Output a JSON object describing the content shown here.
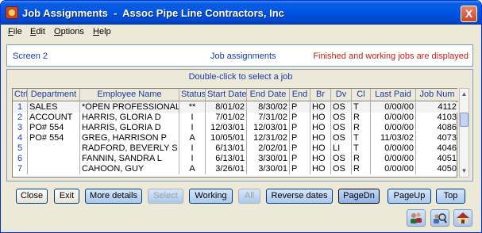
{
  "window": {
    "title": "Job Assignments  -  Assoc Pipe Line Contractors, Inc",
    "close_glyph": "X"
  },
  "menu": [
    {
      "first": "F",
      "rest": "ile"
    },
    {
      "first": "E",
      "rest": "dit"
    },
    {
      "first": "O",
      "rest": "ptions"
    },
    {
      "first": "H",
      "rest": "elp"
    }
  ],
  "header": {
    "screen": "Screen 2",
    "title": "Job assignments",
    "status": "Finished and working jobs are displayed"
  },
  "grid": {
    "caption": "Double-click to select a job",
    "columns": [
      "Ctrl",
      "Department",
      "Employee Name",
      "Status",
      "Start Date",
      "End Date",
      "End",
      "Br",
      "Dv",
      "Cl",
      "Last Paid",
      "Job Num"
    ],
    "rows": [
      {
        "ctrl": "1",
        "department": "SALES",
        "employee": "*OPEN PROFESSIONAL",
        "status": "**",
        "start": "8/01/02",
        "end_date": "8/30/02",
        "end": "P",
        "br": "HO",
        "dv": "OS",
        "cl": "T",
        "last_paid": "0/00/00",
        "job_num": "4112"
      },
      {
        "ctrl": "2",
        "department": "ACCOUNT",
        "employee": "HARRIS, GLORIA D",
        "status": "I",
        "start": "7/01/02",
        "end_date": "7/31/02",
        "end": "P",
        "br": "HO",
        "dv": "OS",
        "cl": "R",
        "last_paid": "0/00/00",
        "job_num": "4103"
      },
      {
        "ctrl": "3",
        "department": "PO# 554",
        "employee": "HARRIS, GLORIA D",
        "status": "I",
        "start": "12/03/01",
        "end_date": "12/03/01",
        "end": "P",
        "br": "HO",
        "dv": "OS",
        "cl": "R",
        "last_paid": "0/00/00",
        "job_num": "4086"
      },
      {
        "ctrl": "4",
        "department": "PO# 554",
        "employee": "GREG, HARRISON P",
        "status": "A",
        "start": "10/05/01",
        "end_date": "12/31/02",
        "end": "P",
        "br": "HO",
        "dv": "OS",
        "cl": "T",
        "last_paid": "11/03/02",
        "job_num": "4073"
      },
      {
        "ctrl": "5",
        "department": "",
        "employee": "RADFORD, BEVERLY S",
        "status": "I",
        "start": "6/13/01",
        "end_date": "2/02/01",
        "end": "P",
        "br": "HO",
        "dv": "LI",
        "cl": "T",
        "last_paid": "0/00/00",
        "job_num": "4046"
      },
      {
        "ctrl": "6",
        "department": "",
        "employee": "FANNIN, SANDRA L",
        "status": "I",
        "start": "6/13/01",
        "end_date": "3/30/01",
        "end": "P",
        "br": "HO",
        "dv": "OS",
        "cl": "R",
        "last_paid": "0/00/00",
        "job_num": "4051"
      },
      {
        "ctrl": "7",
        "department": "",
        "employee": "CAHOON, GUY",
        "status": "A",
        "start": "3/26/01",
        "end_date": "3/30/01",
        "end": "P",
        "br": "HO",
        "dv": "OS",
        "cl": "R",
        "last_paid": "0/00/00",
        "job_num": "4050"
      }
    ]
  },
  "buttons": {
    "close": "Close",
    "exit": "Exit",
    "more_details": "More details",
    "select": "Select",
    "working": "Working",
    "all": "All",
    "reverse_dates": "Reverse dates",
    "page_down": "PageDn",
    "page_up": "PageUp",
    "top": "Top"
  },
  "icons": [
    "people-icon",
    "search-people-icon",
    "house-icon"
  ],
  "colors": {
    "title_bar": "#0054e3",
    "label_blue": "#1a3aa8",
    "status_red": "#c0201a",
    "button_blue": "#aac8f0"
  }
}
